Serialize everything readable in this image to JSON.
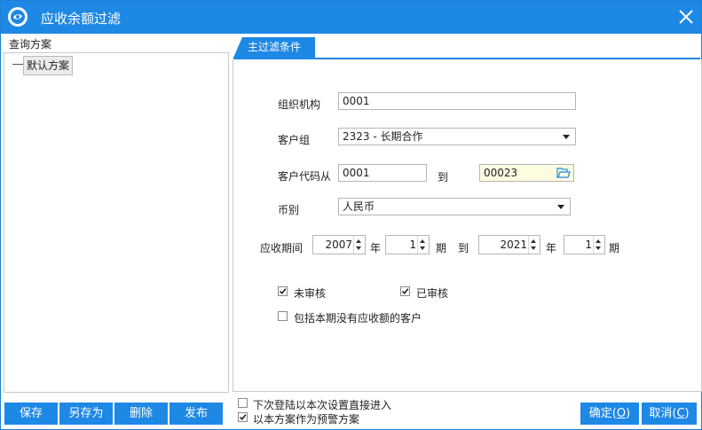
{
  "window": {
    "title": "应收余额过滤"
  },
  "left": {
    "label": "查询方案",
    "tree_item": "默认方案"
  },
  "tab": {
    "label": "主过滤条件"
  },
  "form": {
    "org_label": "组织机构",
    "org_value": "0001",
    "group_label": "客户组",
    "group_value": "2323 - 长期合作",
    "code_from_label": "客户代码从",
    "code_from_value": "0001",
    "code_to_label": "到",
    "code_to_value": "00023",
    "currency_label": "币别",
    "currency_value": "人民币",
    "period_label": "应收期间",
    "start_year": "2007",
    "year_label1": "年",
    "start_period": "1",
    "period_unit1": "期",
    "to_label": "到",
    "end_year": "2021",
    "year_label2": "年",
    "end_period": "1",
    "period_unit2": "期",
    "unaudited_label": "未审核",
    "unaudited_checked": true,
    "audited_label": "已审核",
    "audited_checked": true,
    "include_label": "包括本期没有应收额的客户",
    "include_checked": false
  },
  "bottom": {
    "save": "保存",
    "save_as": "另存为",
    "delete": "删除",
    "publish": "发布",
    "next_login_label": "下次登陆以本次设置直接进入",
    "next_login_checked": false,
    "warning_label": "以本方案作为预警方案",
    "warning_checked": true,
    "ok_text": "确定(",
    "ok_key": "O",
    "ok_end": ")",
    "cancel_text": "取消(",
    "cancel_key": "C",
    "cancel_end": ")"
  },
  "colors": {
    "accent": "#1e88e5",
    "field_highlight": "#fdfbe0"
  }
}
